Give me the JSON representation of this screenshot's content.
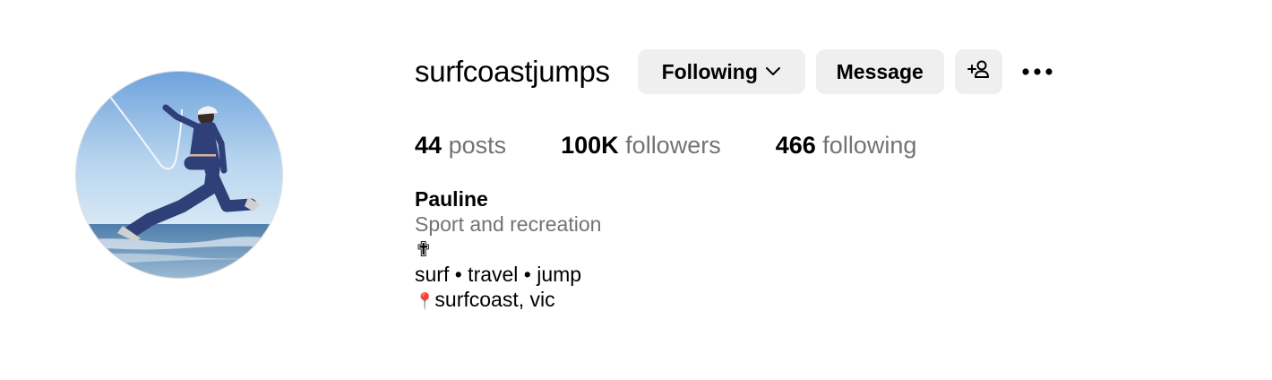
{
  "profile": {
    "username": "surfcoastjumps",
    "following_label": "Following",
    "message_label": "Message",
    "stats": {
      "posts_count": "44",
      "posts_label": "posts",
      "followers_count": "100K",
      "followers_label": "followers",
      "following_count": "466",
      "following_label": "following"
    },
    "bio": {
      "name": "Pauline",
      "category": "Sport and recreation",
      "line1": "✟",
      "line2": "surf • travel • jump",
      "line3_pin": "📍",
      "line3": "surfcoast, vic"
    }
  },
  "icons": {
    "chevron": "chevron-down-icon",
    "add_user": "add-user-icon",
    "more": "more-options-icon"
  },
  "colors": {
    "button_bg": "#efefef",
    "secondary_text": "#737373",
    "primary_text": "#000000"
  }
}
